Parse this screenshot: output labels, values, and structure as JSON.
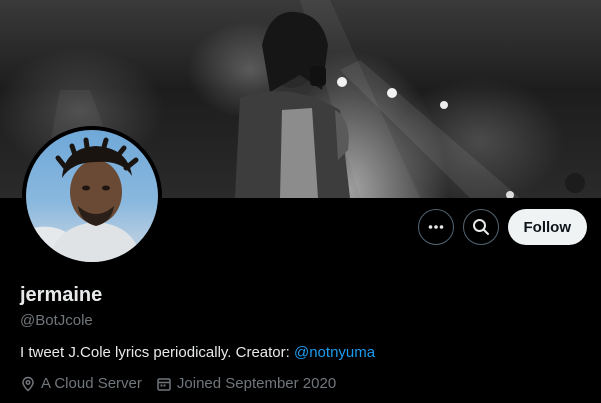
{
  "profile": {
    "display_name": "jermaine",
    "handle": "@BotJcole",
    "bio_text": "I tweet J.Cole lyrics periodically. Creator: ",
    "bio_mention": "@notnyuma",
    "location": "A Cloud Server",
    "joined": "Joined September 2020"
  },
  "actions": {
    "more_icon": "more-dots-icon",
    "search_icon": "search-icon",
    "follow_label": "Follow"
  },
  "colors": {
    "link": "#1d9bf0",
    "secondary_text": "#71767b",
    "follow_button_bg": "#eff3f4"
  }
}
